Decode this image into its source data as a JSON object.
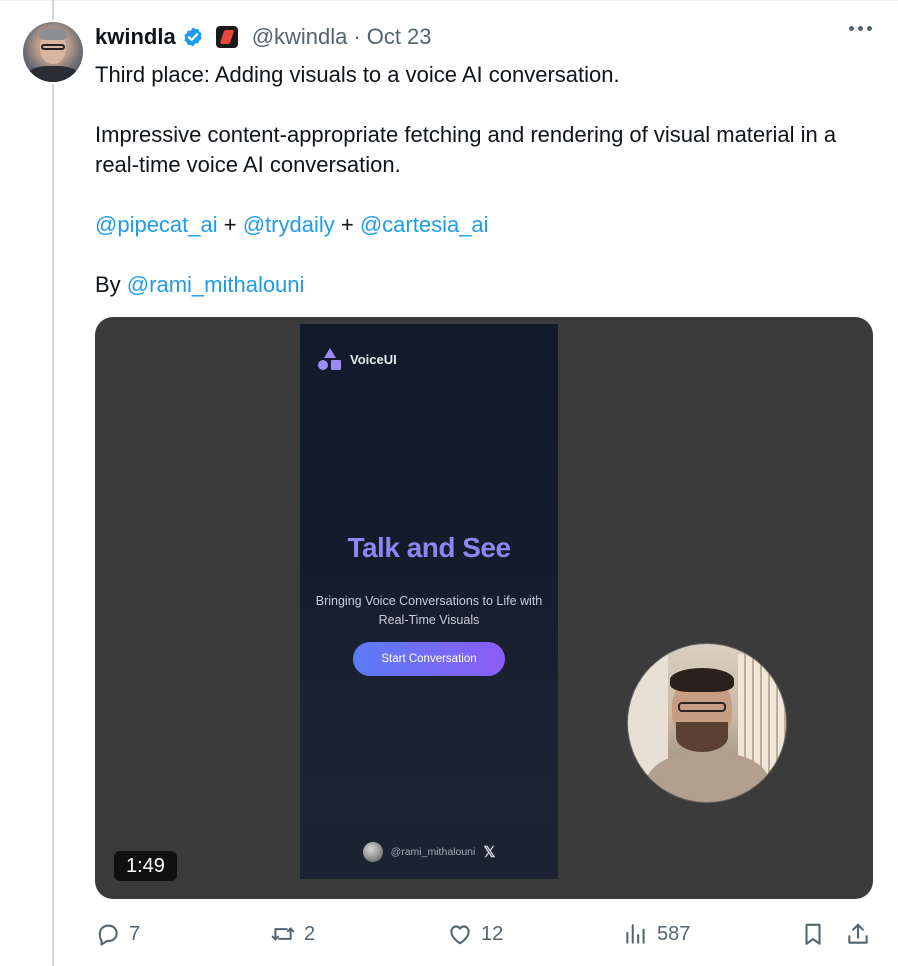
{
  "tweet": {
    "author_name": "kwindla",
    "handle": "@kwindla",
    "separator": "·",
    "date": "Oct 23",
    "text": {
      "line1": "Third place: Adding visuals to a voice AI conversation.",
      "line2": "Impressive content-appropriate fetching and rendering of visual material in a real-time voice AI conversation.",
      "mention1": "@pipecat_ai",
      "plus1": " + ",
      "mention2": "@trydaily",
      "plus2": " + ",
      "mention3": "@cartesia_ai",
      "by_label": "By ",
      "mention4": "@rami_mithalouni"
    }
  },
  "video": {
    "duration": "1:49",
    "app": {
      "brand": "VoiceUI",
      "title": "Talk and See",
      "subtitle_line1": "Bringing Voice Conversations to Life with",
      "subtitle_line2": "Real-Time Visuals",
      "cta": "Start Conversation",
      "footer_handle": "@rami_mithalouni",
      "footer_x": "𝕏"
    }
  },
  "actions": {
    "replies": "7",
    "reposts": "2",
    "likes": "12",
    "views": "587"
  },
  "icons": {
    "verified": "verified-badge-icon",
    "affiliate": "affiliate-badge-icon",
    "more": "more-icon",
    "reply": "reply-icon",
    "repost": "repost-icon",
    "like": "heart-icon",
    "views": "views-chart-icon",
    "bookmark": "bookmark-icon",
    "share": "share-icon"
  },
  "colors": {
    "link": "#1d9bf0",
    "verified": "#1d9bf0",
    "secondary_text": "#536471",
    "app_title": "#8d86f2",
    "cta_gradient_start": "#5a7cf4",
    "cta_gradient_end": "#8b5cf6"
  }
}
